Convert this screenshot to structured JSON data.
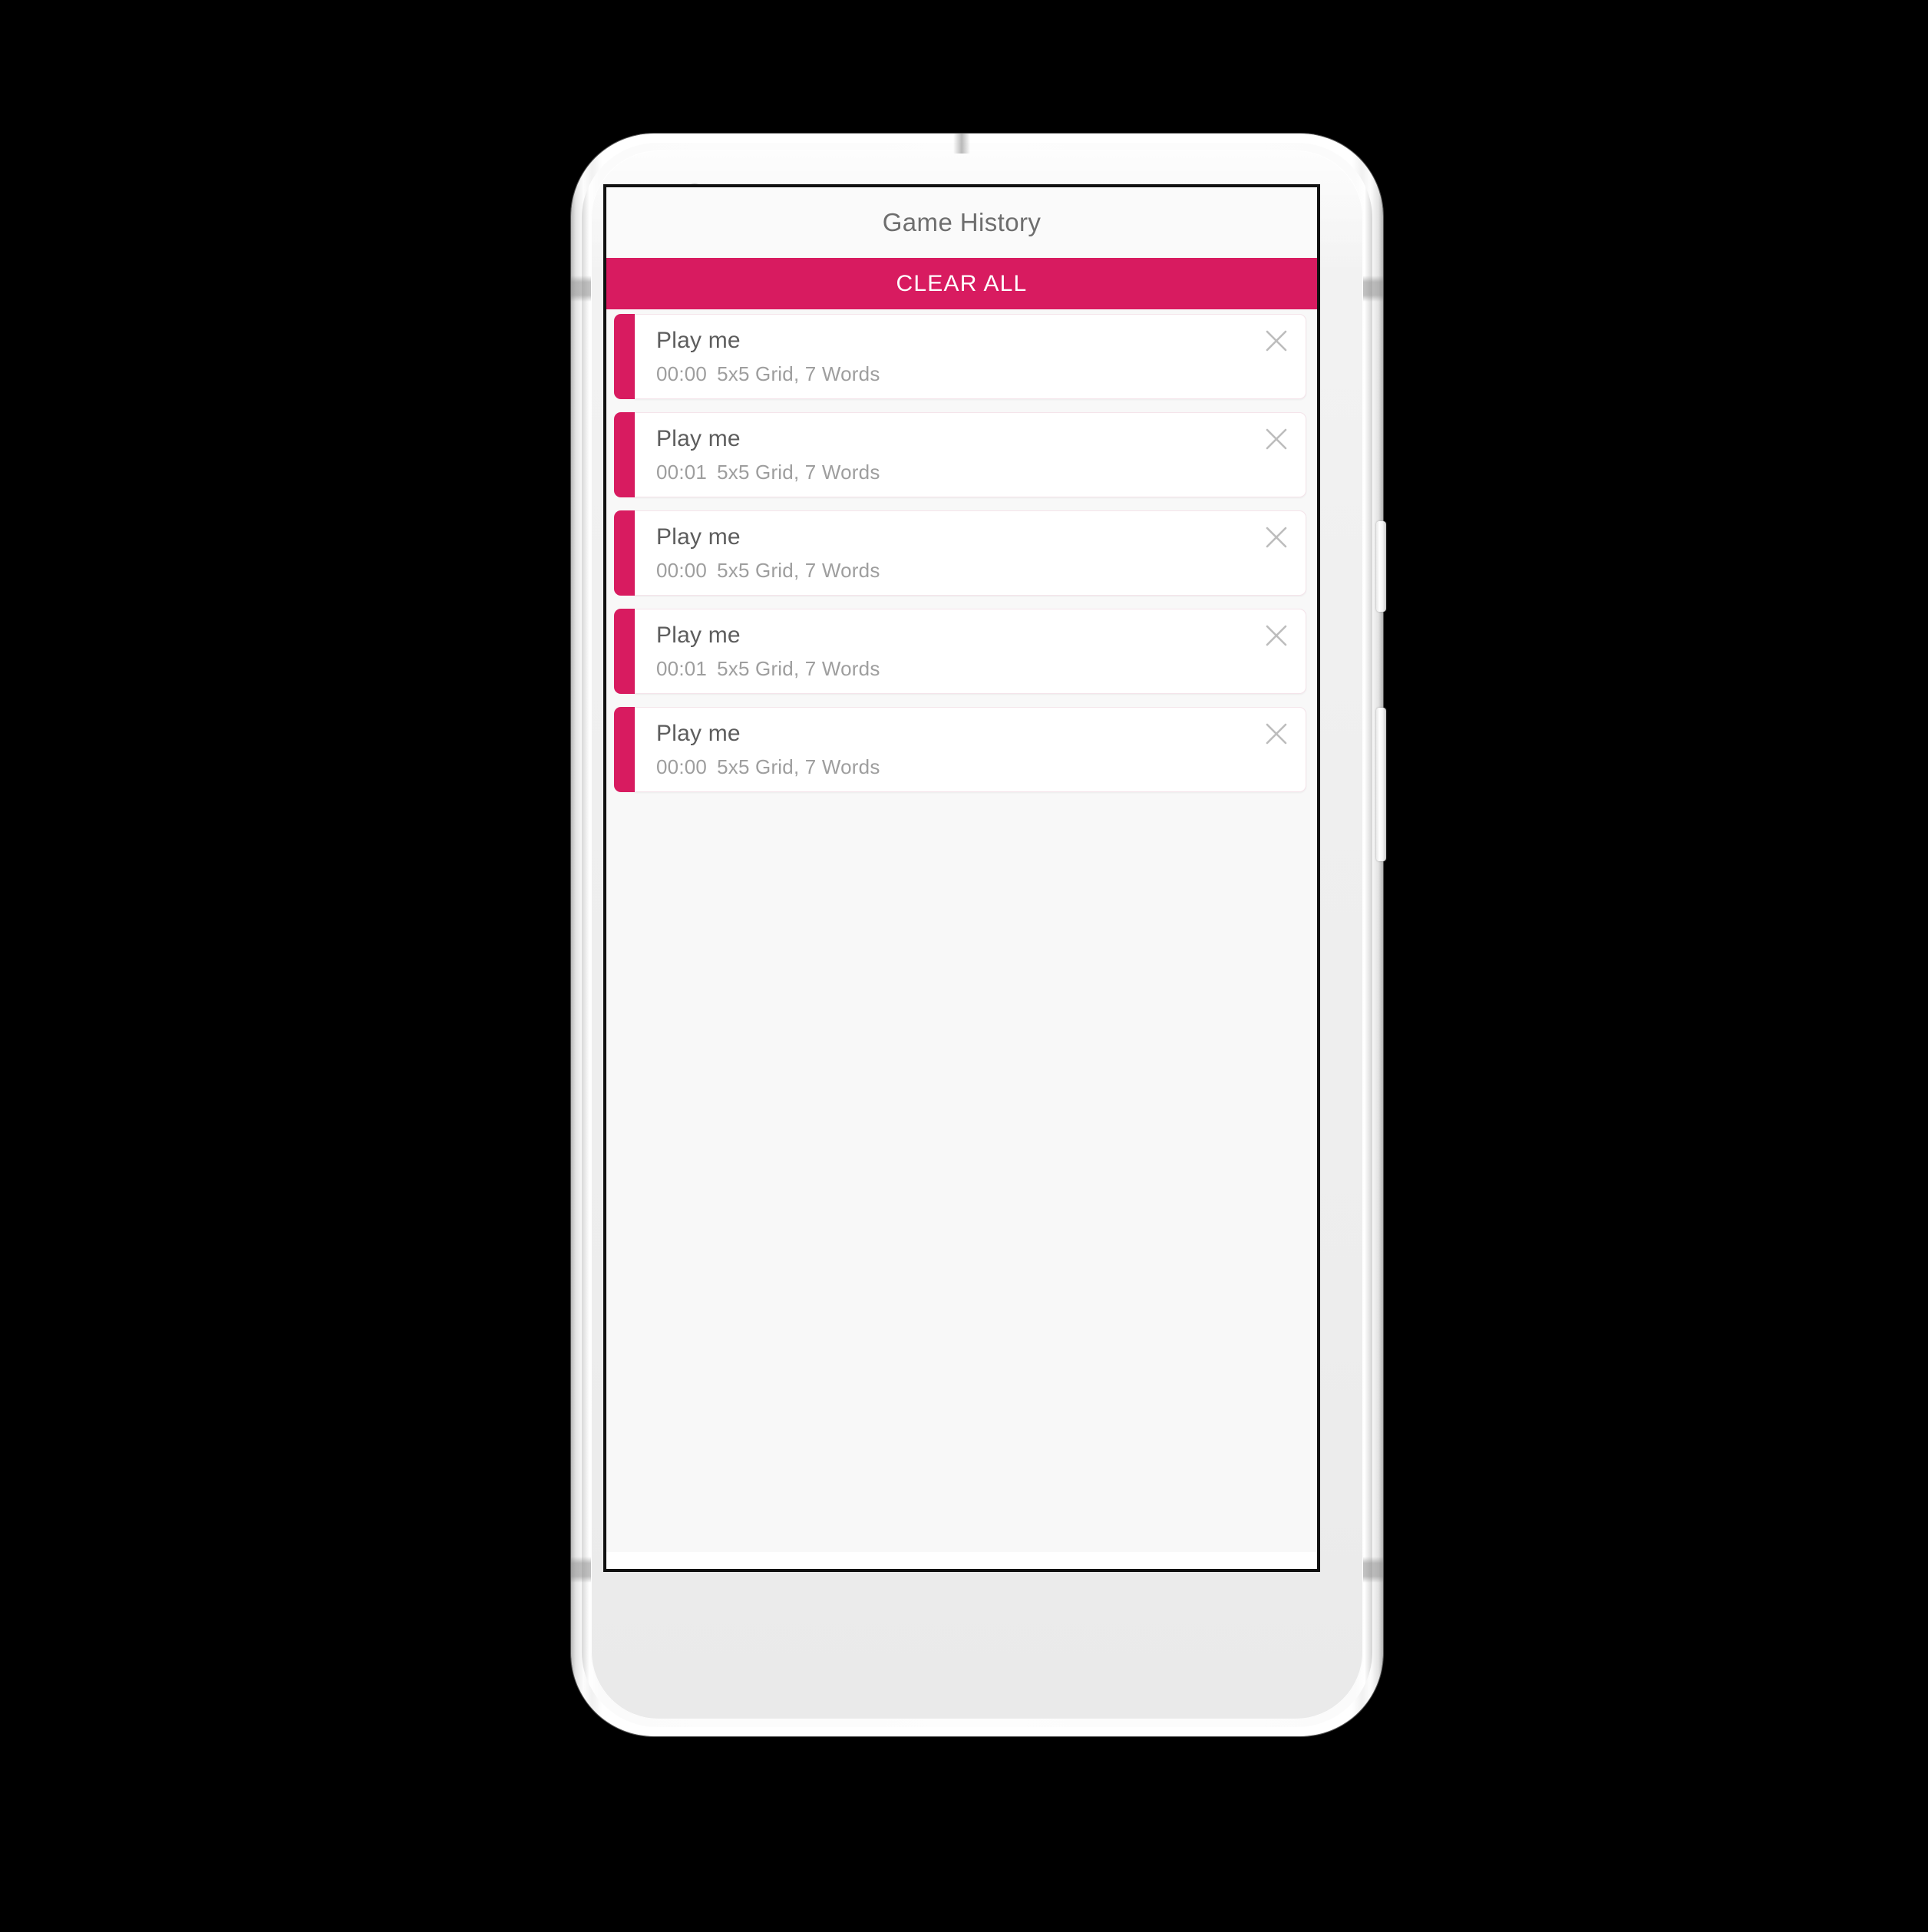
{
  "device": {
    "type": "android-phone-mockup",
    "front_camera": "front-camera-icon",
    "earpiece": "earpiece-speaker-icon",
    "sensor": "proximity-sensor-icon",
    "power_button": "power-button",
    "volume_button": "volume-rocker-button"
  },
  "app": {
    "title": "Game History"
  },
  "toolbar": {
    "clear_all_label": "CLEAR ALL"
  },
  "colors": {
    "accent_pink": "#d81b60",
    "title_gray": "#6e6e6e",
    "card_title_gray": "#5d5d5d",
    "card_sub_gray": "#9e9e9e",
    "close_icon_gray": "#bdbdbd",
    "screen_bg": "#f8f8f8",
    "card_bg": "#ffffff"
  },
  "icons": {
    "close": "close-icon"
  },
  "history": {
    "items": [
      {
        "title": "Play me",
        "time": "00:00",
        "details": "5x5 Grid, 7 Words"
      },
      {
        "title": "Play me",
        "time": "00:01",
        "details": "5x5 Grid, 7 Words"
      },
      {
        "title": "Play me",
        "time": "00:00",
        "details": "5x5 Grid, 7 Words"
      },
      {
        "title": "Play me",
        "time": "00:01",
        "details": "5x5 Grid, 7 Words"
      },
      {
        "title": "Play me",
        "time": "00:00",
        "details": "5x5 Grid, 7 Words"
      }
    ]
  }
}
